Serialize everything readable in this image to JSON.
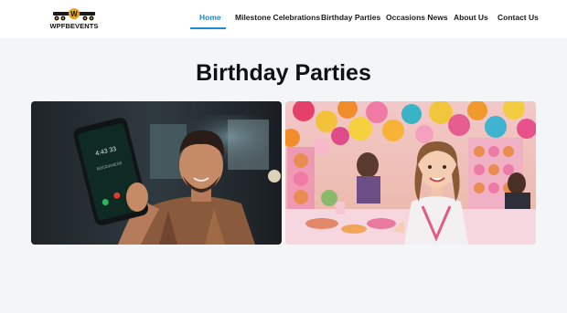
{
  "brand": {
    "name": "WPFBEVENTS"
  },
  "nav": {
    "items": [
      {
        "label": "Home",
        "active": true
      },
      {
        "label": "Milestone Celebrations"
      },
      {
        "label": "Birthday Parties"
      },
      {
        "label": "Occasions News"
      },
      {
        "label": "About Us"
      },
      {
        "label": "Contact Us"
      }
    ]
  },
  "page": {
    "title": "Birthday Parties"
  },
  "phone": {
    "time": "4:43 33",
    "caller": "BOGDANESE"
  },
  "colors": {
    "accent": "#1d8ad8",
    "background": "#f4f5f7",
    "logo_gold": "#e7a31c"
  }
}
